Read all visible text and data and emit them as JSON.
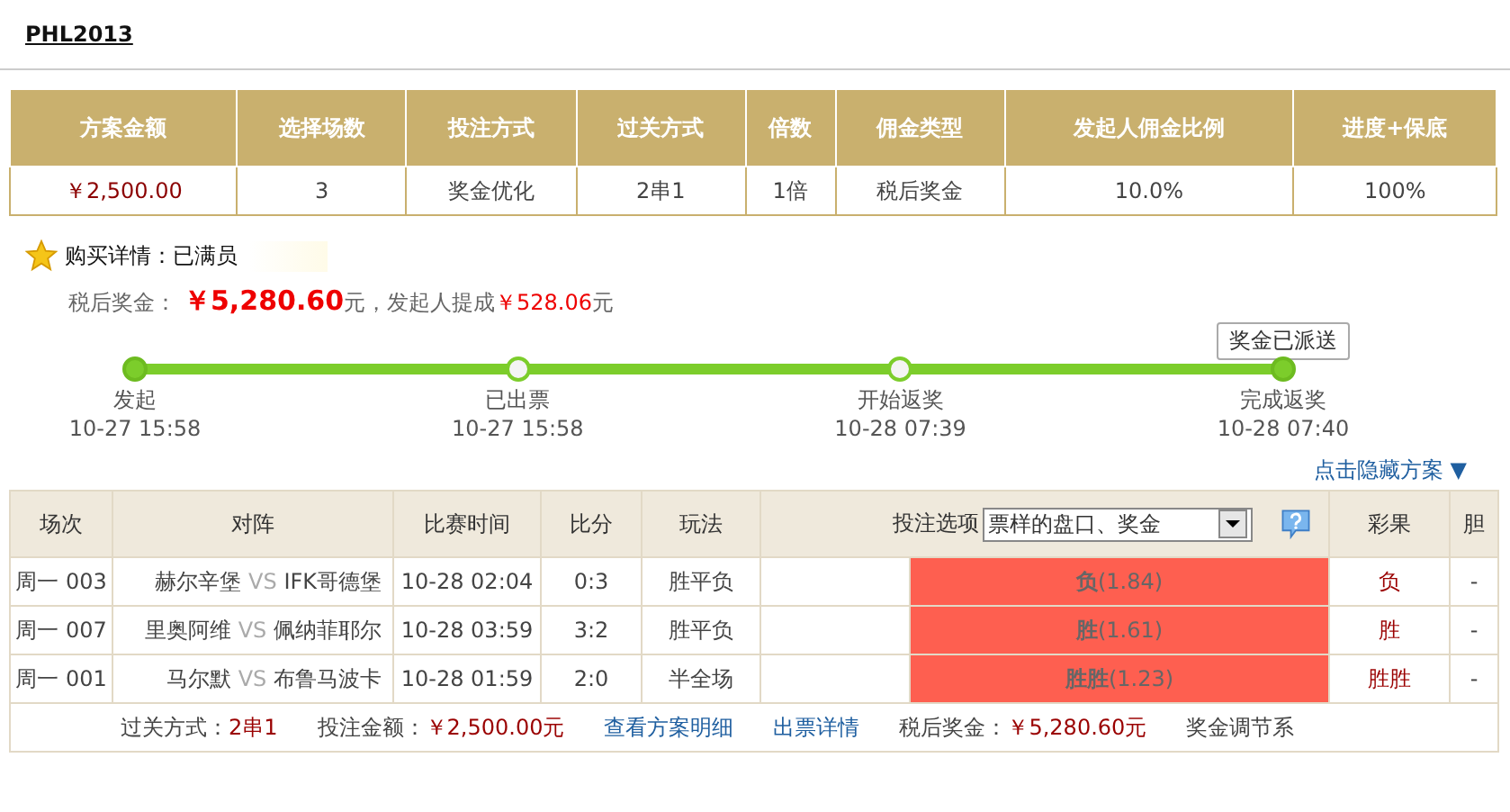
{
  "title": "PHL2013",
  "summary": {
    "columns": [
      "方案金额",
      "选择场数",
      "投注方式",
      "过关方式",
      "倍数",
      "佣金类型",
      "发起人佣金比例",
      "进度+保底"
    ],
    "values": [
      "￥2,500.00",
      "3",
      "奖金优化",
      "2串1",
      "1倍",
      "税后奖金",
      "10.0%",
      "100%"
    ]
  },
  "purchase": {
    "label": "购买详情：",
    "status": "已满员"
  },
  "prize": {
    "label": "税后奖金：",
    "amount": "￥5,280.60",
    "unit": "元，发起人提成",
    "commission": "￥528.06",
    "unit2": "元"
  },
  "sent_button": "奖金已派送",
  "steps": [
    {
      "label": "发起",
      "time": "10-27 15:58",
      "filled": true
    },
    {
      "label": "已出票",
      "time": "10-27 15:58",
      "filled": false
    },
    {
      "label": "开始返奖",
      "time": "10-28 07:39",
      "filled": false
    },
    {
      "label": "完成返奖",
      "time": "10-28 07:40",
      "filled": true
    }
  ],
  "hide_link": "点击隐藏方案 ▼",
  "table": {
    "columns": [
      "场次",
      "对阵",
      "比赛时间",
      "比分",
      "玩法",
      "投注选项",
      "彩果",
      "胆"
    ],
    "option_select": "票样的盘口、奖金",
    "rows": [
      {
        "no": "周一 003",
        "home": "赫尔辛堡",
        "vs": "VS",
        "away": "IFK哥德堡",
        "time": "10-28 02:04",
        "score": "0:3",
        "play": "胜平负",
        "option": "**负**(1.84)",
        "hit": true,
        "result": "负",
        "banker": "-"
      },
      {
        "no": "周一 007",
        "home": "里奥阿维",
        "vs": "VS",
        "away": "佩纳菲耶尔",
        "time": "10-28 03:59",
        "score": "3:2",
        "play": "胜平负",
        "option": "**胜**(1.61)",
        "hit": true,
        "result": "胜",
        "banker": "-"
      },
      {
        "no": "周一 001",
        "home": "马尔默",
        "vs": "VS",
        "away": "布鲁马波卡",
        "time": "10-28 01:59",
        "score": "2:0",
        "play": "半全场",
        "option": "**胜胜**(1.23)",
        "hit": true,
        "result": "胜胜",
        "banker": "-"
      }
    ]
  },
  "footer": {
    "pass_label": "过关方式：",
    "pass": "2串1",
    "bet_label": "投注金额：",
    "bet": "￥2,500.00元",
    "detail_link": "查看方案明细",
    "ticket_link": "出票详情",
    "prize_label": "税后奖金：",
    "prize": "￥5,280.60元",
    "factor_label": "奖金调节系"
  }
}
